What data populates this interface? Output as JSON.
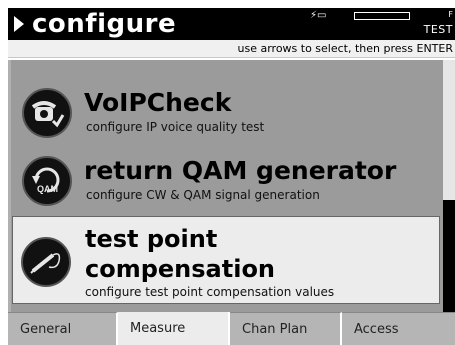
{
  "header": {
    "title": "configure",
    "mode": "TEST",
    "corner_char": "F",
    "status_icon": "power-plug-icon"
  },
  "hint": "use arrows to select, then press ENTER",
  "menu": {
    "items": [
      {
        "title": "VoIPCheck",
        "description": "configure IP voice quality test",
        "icon": "telephone-check-icon"
      },
      {
        "title": "return QAM generator",
        "description": "configure CW & QAM signal generation",
        "icon": "qam-return-icon",
        "icon_text": "QAM"
      },
      {
        "title_line1": "test point",
        "title_line2": "compensation",
        "description": "configure test point compensation values",
        "icon": "probe-icon",
        "selected": true
      }
    ]
  },
  "tabs": [
    {
      "label": "General"
    },
    {
      "label": "Measure",
      "active": true
    },
    {
      "label": "Chan Plan"
    },
    {
      "label": "Access"
    }
  ],
  "colors": {
    "title_bar": "#000000",
    "panel": "#9b9b9b",
    "selected_item": "#ececec",
    "tab_inactive": "#b5b5b5",
    "tab_active": "#ececec"
  }
}
